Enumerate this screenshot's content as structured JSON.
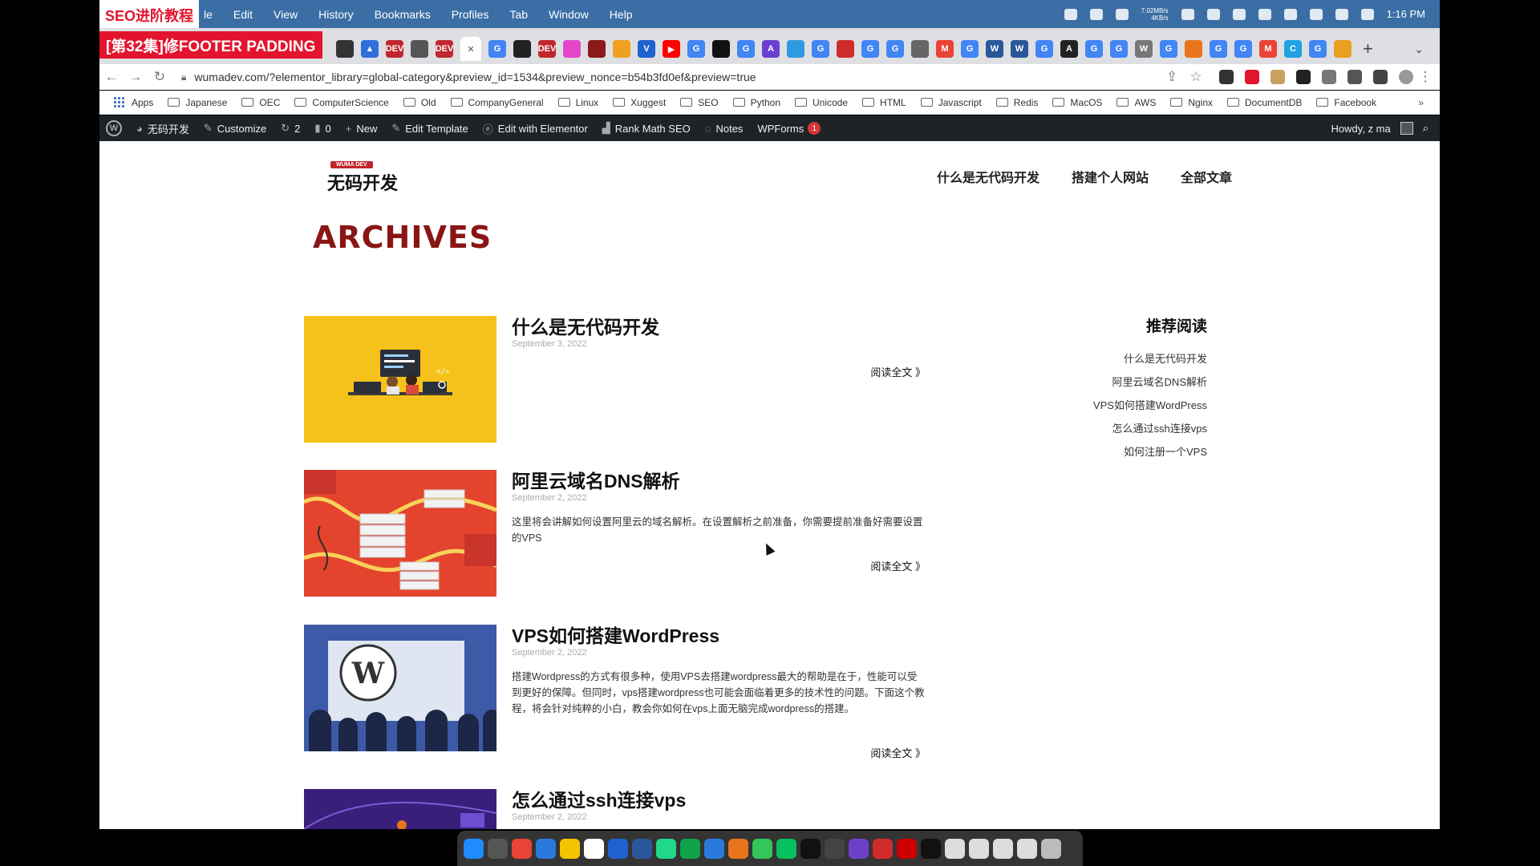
{
  "overlay": {
    "series_title": "SEO进阶教程",
    "episode_title": "[第32集]修FOOTER PADDING"
  },
  "menubar": {
    "items": [
      "le",
      "Edit",
      "View",
      "History",
      "Bookmarks",
      "Profiles",
      "Tab",
      "Window",
      "Help"
    ],
    "net_up": "7.02MB/s",
    "net_down": "4KB/s",
    "time": "1:16 PM"
  },
  "tabstrip": {
    "favicons": [
      {
        "label": "",
        "color": "#333333"
      },
      {
        "label": "▲",
        "color": "#2f6fdc"
      },
      {
        "label": "DEV",
        "color": "#c0272d"
      },
      {
        "label": "",
        "color": "#555555"
      },
      {
        "label": "DEV",
        "color": "#c0272d"
      },
      {
        "label": "✕",
        "color": "#ffffff",
        "active": true
      },
      {
        "label": "G",
        "color": "#4285f4"
      },
      {
        "label": "",
        "color": "#222222"
      },
      {
        "label": "DEV",
        "color": "#c0272d"
      },
      {
        "label": "",
        "color": "#e546c8"
      },
      {
        "label": "",
        "color": "#8b1a1a"
      },
      {
        "label": "",
        "color": "#f0a020"
      },
      {
        "label": "V",
        "color": "#1e62d0"
      },
      {
        "label": "▶",
        "color": "#ff0000"
      },
      {
        "label": "G",
        "color": "#4285f4"
      },
      {
        "label": "",
        "color": "#111111"
      },
      {
        "label": "G",
        "color": "#4285f4"
      },
      {
        "label": "A",
        "color": "#6b3fd1"
      },
      {
        "label": "",
        "color": "#2f9ae0"
      },
      {
        "label": "G",
        "color": "#4285f4"
      },
      {
        "label": "",
        "color": "#d02b2b"
      },
      {
        "label": "G",
        "color": "#4285f4"
      },
      {
        "label": "G",
        "color": "#4285f4"
      },
      {
        "label": "",
        "color": "#666666"
      },
      {
        "label": "M",
        "color": "#ea4335"
      },
      {
        "label": "G",
        "color": "#4285f4"
      },
      {
        "label": "W",
        "color": "#2b579a"
      },
      {
        "label": "W",
        "color": "#2b579a"
      },
      {
        "label": "G",
        "color": "#4285f4"
      },
      {
        "label": "A",
        "color": "#222222"
      },
      {
        "label": "G",
        "color": "#4285f4"
      },
      {
        "label": "G",
        "color": "#4285f4"
      },
      {
        "label": "W",
        "color": "#777777"
      },
      {
        "label": "G",
        "color": "#4285f4"
      },
      {
        "label": "",
        "color": "#e8741c"
      },
      {
        "label": "G",
        "color": "#4285f4"
      },
      {
        "label": "G",
        "color": "#4285f4"
      },
      {
        "label": "M",
        "color": "#ea4335"
      },
      {
        "label": "C",
        "color": "#1fa2e0"
      },
      {
        "label": "G",
        "color": "#4285f4"
      },
      {
        "label": "",
        "color": "#e8a020"
      }
    ],
    "new_tab": "+",
    "tab_menu": "⌄"
  },
  "toolbar": {
    "url": "wumadev.com/?elementor_library=global-category&preview_id=1534&preview_nonce=b54b3fd0ef&preview=true"
  },
  "bookmarks": [
    "Apps",
    "Japanese",
    "OEC",
    "ComputerScience",
    "Old",
    "CompanyGeneral",
    "Linux",
    "Xuggest",
    "SEO",
    "Python",
    "Unicode",
    "HTML",
    "Javascript",
    "Redis",
    "MacOS",
    "AWS",
    "Nginx",
    "DocumentDB",
    "Facebook"
  ],
  "adminbar": {
    "site": "无码开发",
    "customize": "Customize",
    "updates": "2",
    "comments": "0",
    "new": "New",
    "edit_template": "Edit Template",
    "edit_elementor": "Edit with Elementor",
    "rank_math": "Rank Math SEO",
    "notes": "Notes",
    "wpforms": "WPForms",
    "wpforms_badge": "1",
    "howdy": "Howdy, z ma"
  },
  "site": {
    "logo_tag": "WUMA DEV",
    "logo_text": "无码开发",
    "nav": [
      "什么是无代码开发",
      "搭建个人网站",
      "全部文章"
    ],
    "archive_title": "ARCHIVES"
  },
  "posts": [
    {
      "title": "什么是无代码开发",
      "date": "September 3, 2022",
      "excerpt": "",
      "read_more": "阅读全文 》"
    },
    {
      "title": "阿里云域名DNS解析",
      "date": "September 2, 2022",
      "excerpt": "这里将会讲解如何设置阿里云的域名解析。在设置解析之前准备，你需要提前准备好需要设置的VPS",
      "read_more": "阅读全文 》"
    },
    {
      "title": "VPS如何搭建WordPress",
      "date": "September 2, 2022",
      "excerpt": "搭建Wordpress的方式有很多种，使用VPS去搭建wordpress最大的帮助是在于，性能可以受到更好的保障。但同时，vps搭建wordpress也可能会面临着更多的技术性的问题。下面这个教程，将会针对纯粹的小白，教会你如何在vps上面无脑完成wordpress的搭建。",
      "read_more": "阅读全文 》"
    },
    {
      "title": "怎么通过ssh连接vps",
      "date": "September 2, 2022",
      "excerpt": "",
      "read_more": ""
    }
  ],
  "sidebar": {
    "title": "推荐阅读",
    "links": [
      "什么是无代码开发",
      "阿里云域名DNS解析",
      "VPS如何搭建WordPress",
      "怎么通过ssh连接vps",
      "如何注册一个VPS"
    ]
  },
  "colors": {
    "menubar": "#3a6ea5",
    "accent_red": "#e3142d",
    "archive_title": "#8a1515",
    "adminbar": "#1d2327"
  },
  "dock": [
    "#1e8bff",
    "#555555",
    "#ea4335",
    "#2a7ade",
    "#f5c400",
    "#ffffff",
    "#1e62d0",
    "#2b579a",
    "#21d789",
    "#0fa34a",
    "#2a7ade",
    "#e8741c",
    "#33c659",
    "#07c160",
    "#111111",
    "#444444",
    "#6e40c9",
    "#d02b2b",
    "#cc0000",
    "#111111",
    "#dddddd",
    "#dddddd",
    "#dddddd",
    "#dddddd",
    "#bbbbbb"
  ]
}
